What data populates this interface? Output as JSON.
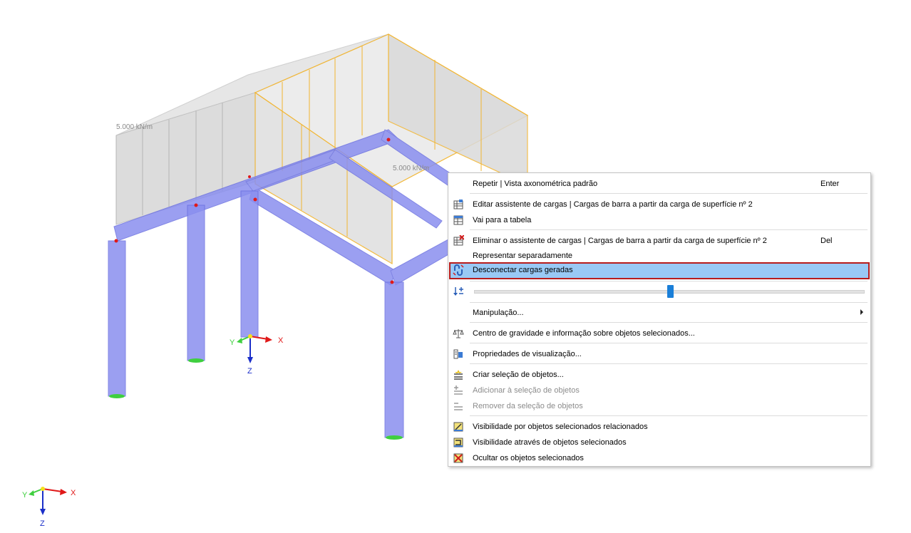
{
  "viewport": {
    "load_label_1": "5.000 kN/m",
    "load_label_2": "5.000 kN/m",
    "model_axes": {
      "x": "X",
      "y": "Y",
      "z": "Z"
    },
    "corner_axes": {
      "x": "X",
      "y": "Y",
      "z": "Z"
    }
  },
  "context_menu": {
    "items": [
      {
        "label": "Repetir | Vista axonométrica padrão",
        "shortcut": "Enter",
        "icon": "none"
      },
      {
        "label": "Editar assistente de cargas | Cargas de barra a partir da carga de superfície nº 2",
        "icon": "load-wizard-edit-icon"
      },
      {
        "label": "Vai para a tabela",
        "icon": "table-icon"
      },
      {
        "label": "Eliminar o assistente de cargas | Cargas de barra a partir da carga de superfície nº 2",
        "shortcut": "Del",
        "icon": "load-wizard-delete-icon"
      },
      {
        "label": "Representar separadamente",
        "icon": "none"
      },
      {
        "label": "Desconectar cargas geradas",
        "icon": "disconnect-link-icon",
        "highlighted": true
      },
      {
        "label": "Manipulação...",
        "icon": "none",
        "submenu": true
      },
      {
        "label": "Centro de gravidade e informação sobre objetos selecionados...",
        "icon": "balance-scale-icon"
      },
      {
        "label": "Propriedades de visualização...",
        "icon": "display-properties-icon"
      },
      {
        "label": "Criar seleção de objetos...",
        "icon": "create-selection-icon"
      },
      {
        "label": "Adicionar à seleção de objetos",
        "icon": "add-selection-icon",
        "disabled": true
      },
      {
        "label": "Remover da seleção de objetos",
        "icon": "remove-selection-icon",
        "disabled": true
      },
      {
        "label": "Visibilidade por objetos selecionados relacionados",
        "icon": "visibility-related-icon"
      },
      {
        "label": "Visibilidade através de objetos selecionados",
        "icon": "visibility-through-icon"
      },
      {
        "label": "Ocultar os objetos selecionados",
        "icon": "hide-objects-icon"
      }
    ],
    "slider": {
      "icon": "sort-plus-minus-icon",
      "value_percent": 50
    }
  },
  "colors": {
    "member": "#8a8fef",
    "member_edge": "#6b70e0",
    "load_gray": "#d6d6d6",
    "load_yellow": "#f2b530",
    "highlight_fill": "#99c9f5",
    "highlight_border": "#b71c1c",
    "support": "#3fcf3f",
    "node": "#e01919"
  }
}
